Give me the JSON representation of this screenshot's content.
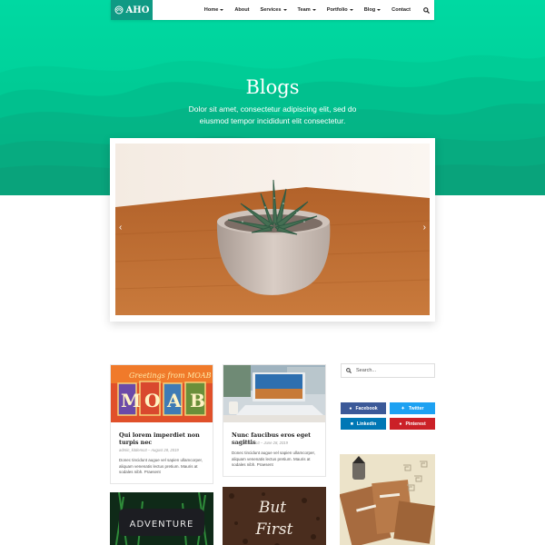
{
  "brand": {
    "name": "AHO"
  },
  "nav": {
    "items": [
      {
        "label": "Home",
        "dropdown": true
      },
      {
        "label": "About",
        "dropdown": false
      },
      {
        "label": "Services",
        "dropdown": true
      },
      {
        "label": "Team",
        "dropdown": true
      },
      {
        "label": "Portfolio",
        "dropdown": true
      },
      {
        "label": "Blog",
        "dropdown": true
      },
      {
        "label": "Contact",
        "dropdown": false
      }
    ],
    "search_icon": "search-icon"
  },
  "hero": {
    "title": "Blogs",
    "subtitle": "Dolor sit amet, consectetur adipiscing elit, sed do eiusmod tempor incididunt elit consectetur."
  },
  "slider": {
    "prev_icon": "chevron-left-icon",
    "next_icon": "chevron-right-icon"
  },
  "posts": [
    {
      "image_text": "Greetings from MOAB",
      "title": "Qui lorem imperdiet non turpis nec",
      "meta": "admin_kitdemo3 – August 28, 2019",
      "excerpt": "Donec tincidunt augue vel sapien ullamcorper, aliquam venenatis lectus pretium. Mauris at sodales nibh. Praesent"
    },
    {
      "title": "Nunc faucibus eros eget sagittis",
      "meta": "admin_kitdemo3 – June 28, 2019",
      "excerpt": "Donec tincidunt augue vel sapien ullamcorper, aliquam venenatis lectus pretium. Mauris at sodales nibh. Praesent"
    },
    {
      "image_text": "ADVENTURE"
    },
    {
      "image_text_1": "But",
      "image_text_2": "First"
    }
  ],
  "sidebar": {
    "search_placeholder": "Search...",
    "social": [
      {
        "label": "Facebook",
        "color": "#3b5998",
        "icon": "facebook-icon"
      },
      {
        "label": "Twitter",
        "color": "#1da1f2",
        "icon": "twitter-icon"
      },
      {
        "label": "Linkedin",
        "color": "#0077b5",
        "icon": "linkedin-icon"
      },
      {
        "label": "Pinterest",
        "color": "#cb2027",
        "icon": "pinterest-icon"
      }
    ]
  },
  "colors": {
    "accent": "#00d19a",
    "logo_bg": "#0f9a84"
  }
}
